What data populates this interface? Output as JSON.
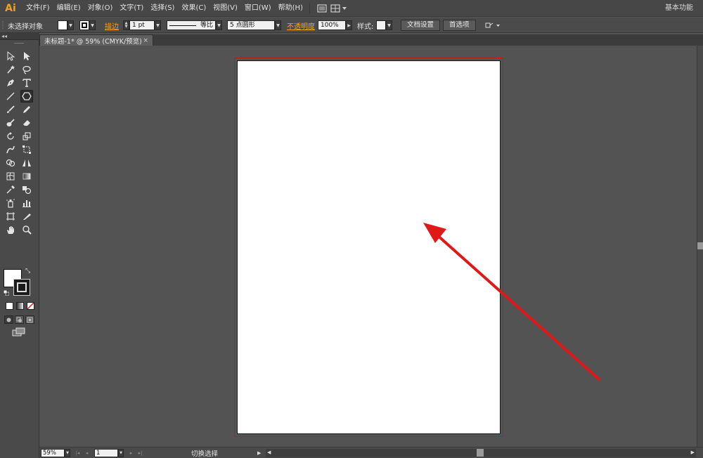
{
  "app": {
    "logo": "Ai"
  },
  "menu": {
    "items": [
      "文件(F)",
      "编辑(E)",
      "对象(O)",
      "文字(T)",
      "选择(S)",
      "效果(C)",
      "视图(V)",
      "窗口(W)",
      "帮助(H)"
    ],
    "workspace": "基本功能"
  },
  "control": {
    "selection_label": "未选择对象",
    "stroke_label": "描边",
    "stroke_weight": "1 pt",
    "profile_label": "等比",
    "brush_label": "5 点圆形",
    "opacity_label": "不透明度",
    "opacity_value": "100%",
    "style_label": "样式:",
    "doc_setup_button": "文档设置",
    "preferences_button": "首选项"
  },
  "document": {
    "tab_title": "未标题-1* @ 59% (CMYK/预览)",
    "close_glyph": "×"
  },
  "tools": {
    "collapse_glyph": "◂◂",
    "swap_glyph": "⤡"
  },
  "status": {
    "zoom": "59%",
    "page": "1",
    "toggle_label": "切换选择"
  },
  "colors": {
    "accent_orange": "#f6a11a",
    "artboard_frame": "#b81e1e",
    "annotation_arrow": "#e01818",
    "canvas_bg": "#535353"
  },
  "icons": [
    "selection-tool-icon",
    "direct-selection-tool-icon",
    "magic-wand-icon",
    "lasso-icon",
    "pen-icon",
    "type-icon",
    "line-icon",
    "polygon-icon",
    "paintbrush-icon",
    "pencil-icon",
    "blob-brush-icon",
    "eraser-icon",
    "rotate-icon",
    "scale-icon",
    "warp-icon",
    "free-transform-icon",
    "shape-builder-icon",
    "perspective-grid-icon",
    "mesh-icon",
    "gradient-icon",
    "eyedropper-icon",
    "blend-icon",
    "symbol-sprayer-icon",
    "column-graph-icon",
    "artboard-tool-icon",
    "slice-icon",
    "hand-icon",
    "zoom-icon"
  ]
}
